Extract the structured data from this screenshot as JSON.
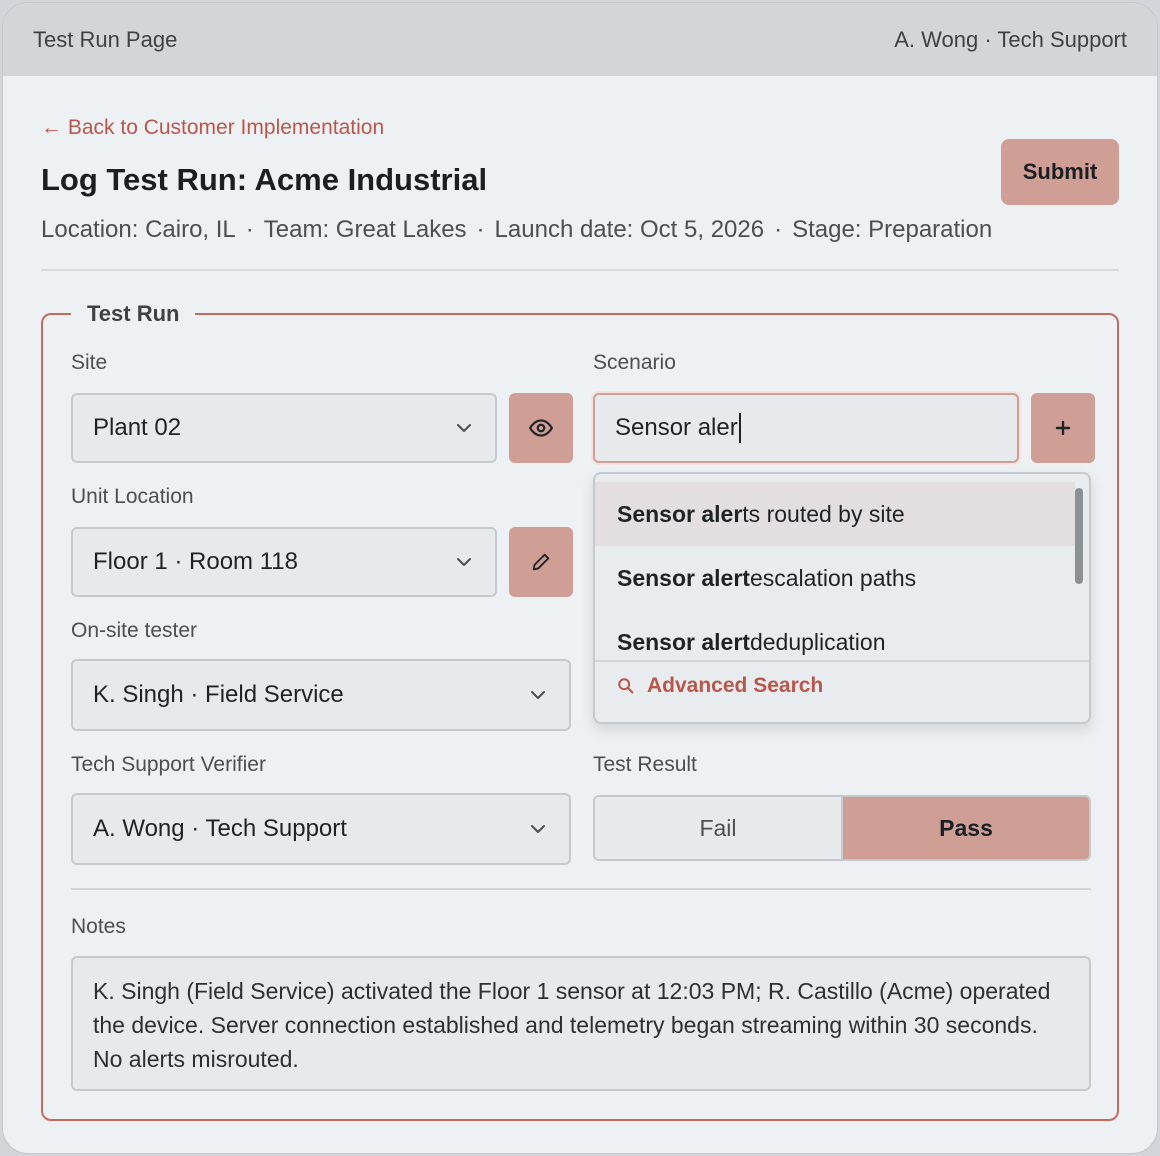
{
  "window": {
    "title": "Test Run Page",
    "user": "A. Wong · Tech Support"
  },
  "header": {
    "back_link": "← Back to Customer Implementation",
    "title": "Log Test Run: Acme Industrial",
    "submit_label": "Submit",
    "meta": {
      "location": "Location: Cairo, IL",
      "team": "Team: Great Lakes",
      "launch": "Launch date: Oct 5, 2026",
      "stage": "Stage: Preparation",
      "separator": "·"
    }
  },
  "form": {
    "legend": "Test Run",
    "site": {
      "label": "Site",
      "value": "Plant 02"
    },
    "scenario": {
      "label": "Scenario",
      "value": "Sensor aler",
      "suggestions": [
        {
          "match": "Sensor aler",
          "rest": "ts routed by site"
        },
        {
          "match": "Sensor alert",
          "rest": " escalation paths"
        },
        {
          "match": "Sensor alert",
          "rest": " deduplication"
        }
      ],
      "advanced_search": "Advanced Search"
    },
    "unit_location": {
      "label": "Unit Location",
      "value": "Floor 1 · Room 118"
    },
    "tester": {
      "label": "On-site tester",
      "value": "K. Singh · Field Service"
    },
    "verifier": {
      "label": "Tech Support Verifier",
      "value": "A. Wong · Tech Support"
    },
    "result": {
      "label": "Test Result",
      "options": [
        "Fail",
        "Pass"
      ],
      "selected": "Pass"
    },
    "notes": {
      "label": "Notes",
      "value": "K. Singh (Field Service) activated the Floor 1 sensor at 12:03 PM; R. Castillo (Acme) operated the device. Server connection established and telemetry began streaming within 30 seconds. No alerts misrouted."
    }
  },
  "colors": {
    "accent": "#cf9f96",
    "link": "#b8574c",
    "border_accent": "#c56a5d"
  },
  "icons": {
    "site_button": "eye-icon",
    "unit_button": "pencil-icon",
    "scenario_button": "plus-icon",
    "dropdown": "chevron-down-icon",
    "advanced_search": "search-icon"
  }
}
